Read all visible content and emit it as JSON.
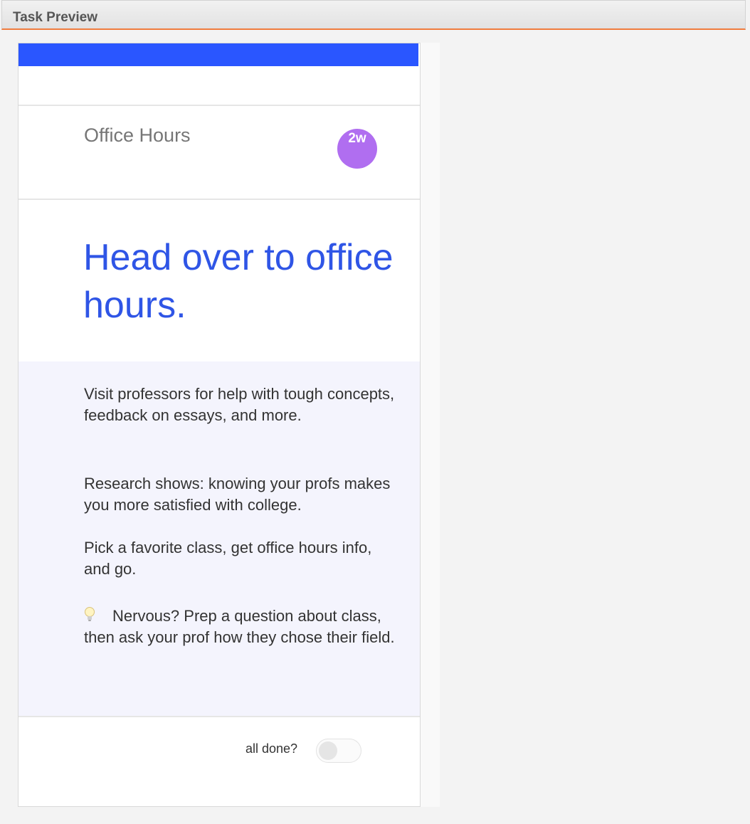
{
  "panel": {
    "title": "Task Preview"
  },
  "task": {
    "course": "Office Hours",
    "time_badge": "2w",
    "headline": "Head over to office hours.",
    "paragraphs": [
      "Visit professors for help with tough concepts, feedback on essays, and more.",
      "Research shows: knowing your profs makes you more satisfied with college.",
      "Pick a favorite class, get office hours info, and go."
    ],
    "tip": {
      "icon": "lightbulb-icon",
      "text": "Nervous? Prep a question about class, then ask your prof how they chose their field."
    },
    "done_label": "all done?",
    "done": false
  },
  "colors": {
    "top_bar": "#2a56ff",
    "headline": "#2f55e6",
    "badge": "#b06ef0",
    "accent_line": "#f07c3e"
  }
}
